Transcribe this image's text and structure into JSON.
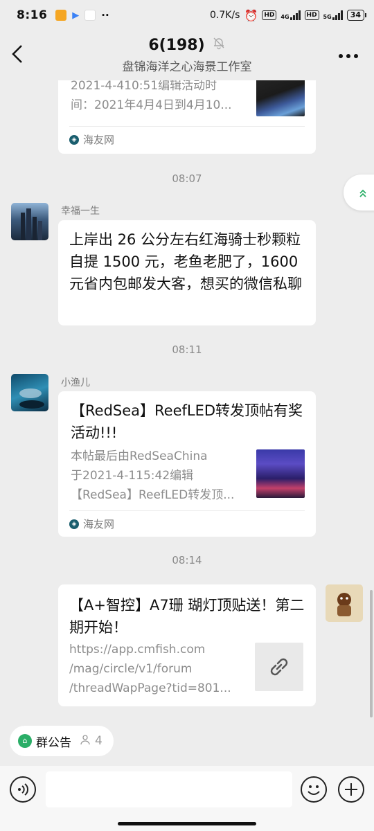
{
  "status_bar": {
    "time": "8:16",
    "net_speed": "0.7K/s",
    "hd1": "HD",
    "net1": "4G",
    "hd2": "HD",
    "net2": "5G",
    "battery": "34",
    "alarm_icon": "alarm-clock-icon"
  },
  "header": {
    "back_icon": "back-arrow-icon",
    "title": "6(198)",
    "mute_icon": "bell-off-icon",
    "subtitle": "盘锦海洋之心海景工作室",
    "more_icon": "more-dots-icon"
  },
  "float_button": {
    "icon": "double-chevron-up-icon",
    "glyph": "«"
  },
  "messages": {
    "card0": {
      "line0": "2021-4-410:51编辑活动时",
      "line1": "间：2021年4月4日到4月10...",
      "source": "海友网"
    },
    "ts1": "08:07",
    "msg1": {
      "sender": "幸福一生",
      "text": "上岸出 26 公分左右红海骑士秒颗粒自提 1500 元，老鱼老肥了，1600 元省内包邮发大客，想买的微信私聊"
    },
    "ts2": "08:11",
    "msg2": {
      "sender": "小渔儿",
      "title": "【RedSea】ReefLED转发顶帖有奖活动!!!",
      "desc0": "本帖最后由RedSeaChina",
      "desc1": "于2021-4-115:42编辑",
      "desc2": "【RedSea】ReefLED转发顶...",
      "source": "海友网"
    },
    "ts3": "08:14",
    "msg3": {
      "title": "【A+智控】A7珊 瑚灯顶贴送！第二期开始！",
      "url0": "https://app.cmfish.com",
      "url1": "/mag/circle/v1/forum",
      "url2": "/threadWapPage?tid=801...",
      "link_icon": "link-icon"
    }
  },
  "notice": {
    "label": "群公告",
    "icon": "announcement-icon",
    "member_icon": "person-icon",
    "count": "4"
  },
  "input_bar": {
    "voice_icon": "voice-icon",
    "placeholder": "",
    "emoji_icon": "emoji-icon",
    "plus_icon": "plus-icon"
  },
  "colors": {
    "accent": "#2aae67",
    "background": "#ededed",
    "bubble": "#ffffff"
  }
}
